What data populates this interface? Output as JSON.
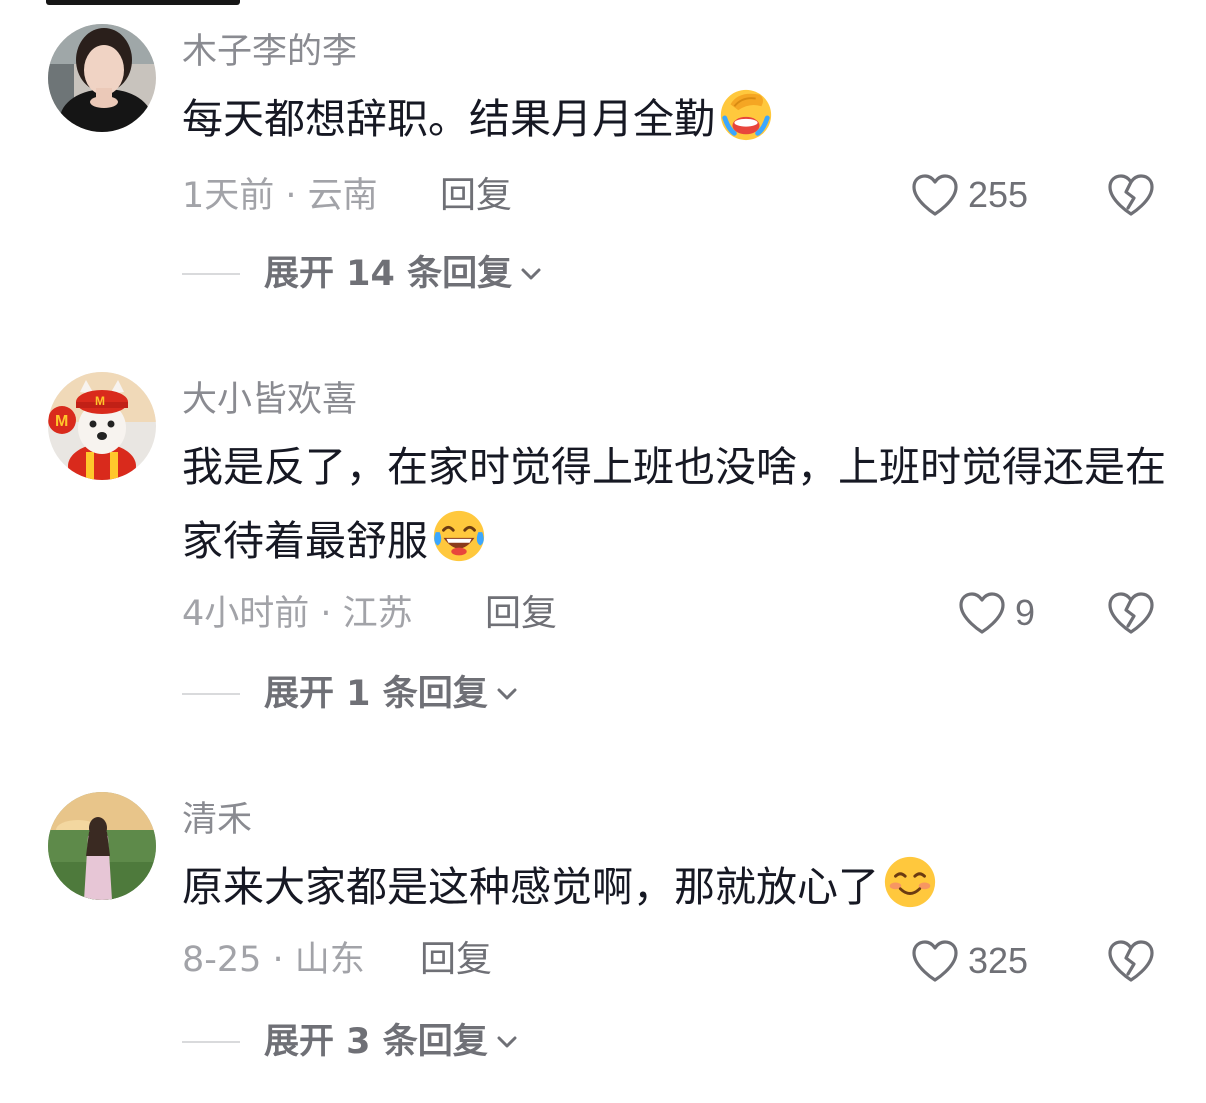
{
  "comments": [
    {
      "username": "木子李的李",
      "text": "每天都想辞职。结果月月全勤",
      "emoji": "facepalm-crying-emoji",
      "meta": "1天前 · 云南",
      "reply_label": "回复",
      "likes": "255",
      "expand_label": "展开 14 条回复",
      "avatar": "woman-portrait"
    },
    {
      "username": "大小皆欢喜",
      "text": "我是反了，在家时觉得上班也没啥，上班时觉得还是在家待着最舒服",
      "emoji": "laughing-tears-emoji",
      "meta": "4小时前 · 江苏",
      "reply_label": "回复",
      "likes": "9",
      "expand_label": "展开 1 条回复",
      "avatar": "dog-in-red-cap"
    },
    {
      "username": "清禾",
      "text": "原来大家都是这种感觉啊，那就放心了",
      "emoji": "smiling-blush-emoji",
      "meta": "8-25 · 山东",
      "reply_label": "回复",
      "likes": "325",
      "expand_label": "展开 3 条回复",
      "avatar": "girl-at-sunset"
    }
  ],
  "colors": {
    "text": "#161823",
    "username": "#8a8b91",
    "meta": "#a2a3a8",
    "action": "#6f7076"
  },
  "icons": {
    "like": "heart-outline-icon",
    "dislike": "broken-heart-icon",
    "expand": "chevron-down-icon"
  }
}
